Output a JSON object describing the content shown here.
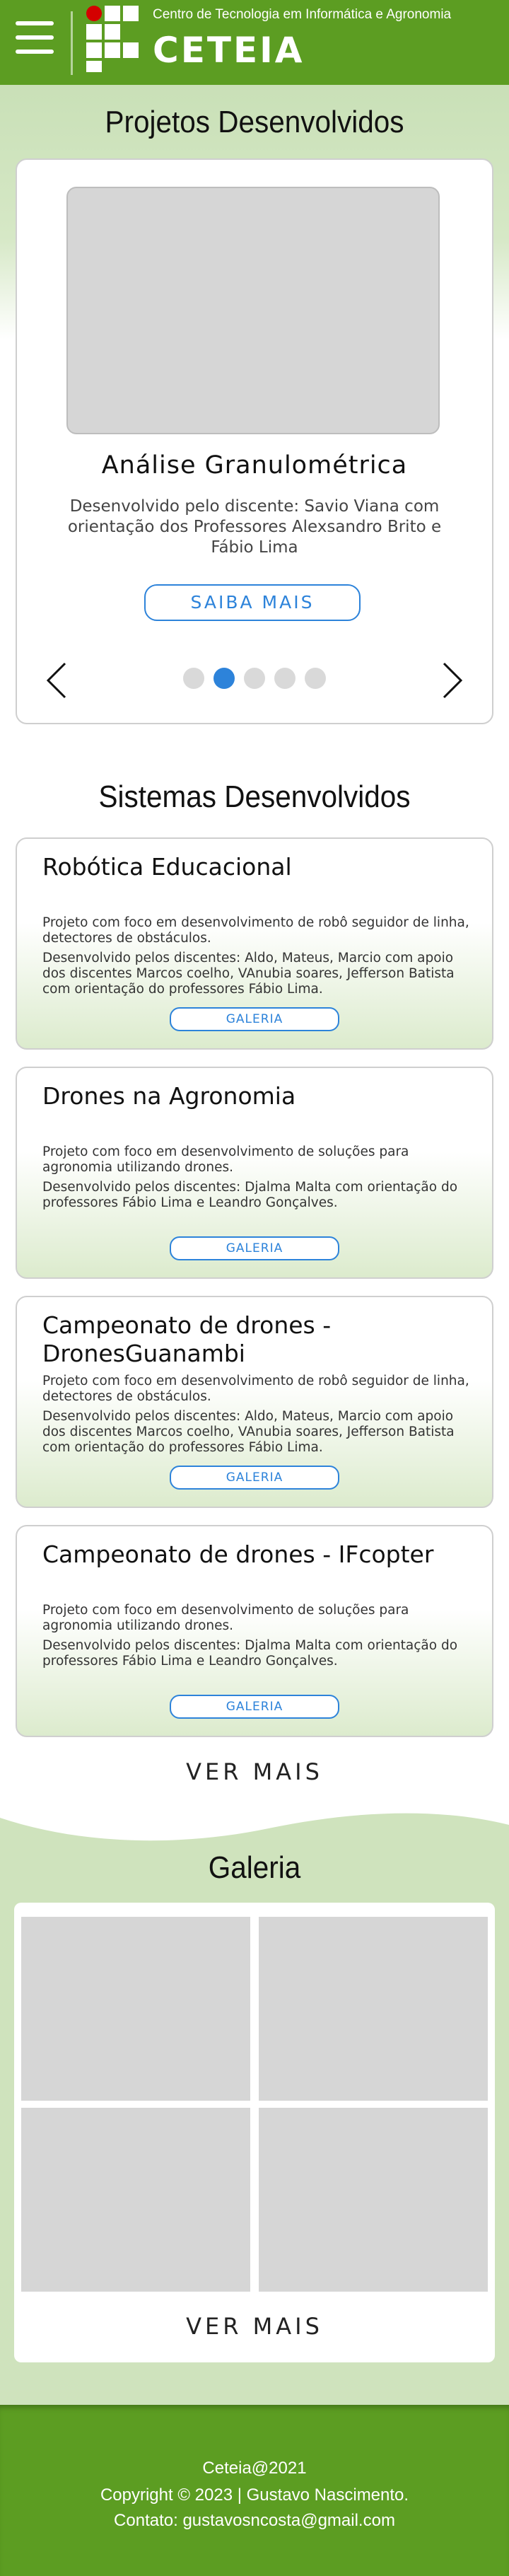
{
  "header": {
    "subtitle": "Centro de Tecnologia em Informática e Agronomia",
    "title": "CETEIA",
    "menu_icon": "hamburger-icon",
    "colors": {
      "brand_green": "#5c9d22",
      "logo_red": "#d40000"
    }
  },
  "projects": {
    "section_title": "Projetos Desenvolvidos",
    "current": {
      "title": "Análise Granulométrica",
      "description": "Desenvolvido pelo discente: Savio Viana com orientação dos Professores Alexsandro Brito e Fábio Lima",
      "button": "SAIBA MAIS"
    },
    "slide_count": 5,
    "active_slide": 2,
    "accent": "#2d83da"
  },
  "systems": {
    "section_title": "Sistemas Desenvolvidos",
    "cards": [
      {
        "title": "Robótica Educacional",
        "desc": "Projeto com foco em desenvolvimento de robô seguidor de linha, detectores de obstáculos.",
        "team": "Desenvolvido pelos discentes: Aldo, Mateus, Marcio com apoio dos discentes Marcos coelho, VAnubia soares, Jefferson Batista com orientação do professores Fábio Lima.",
        "button": "GALERIA"
      },
      {
        "title": "Drones na Agronomia",
        "desc": "Projeto com foco em desenvolvimento de soluções para agronomia utilizando drones.",
        "team": "Desenvolvido pelos discentes: Djalma Malta com orientação do professores Fábio Lima e Leandro Gonçalves.",
        "button": "GALERIA"
      },
      {
        "title": "Campeonato de drones - DronesGuanambi",
        "desc": "Projeto com foco em desenvolvimento de robô seguidor de linha, detectores de obstáculos.",
        "team": "Desenvolvido pelos discentes: Aldo, Mateus, Marcio com apoio dos discentes Marcos coelho, VAnubia soares, Jefferson Batista com orientação do professores Fábio Lima.",
        "button": "GALERIA"
      },
      {
        "title": "Campeonato de drones - IFcopter",
        "desc": "Projeto com foco em desenvolvimento de soluções para agronomia utilizando drones.",
        "team": "Desenvolvido pelos discentes: Djalma Malta com orientação do professores Fábio Lima e Leandro Gonçalves.",
        "button": "GALERIA"
      }
    ],
    "more": "VER MAIS"
  },
  "gallery": {
    "section_title": "Galeria",
    "more": "VER MAIS"
  },
  "footer": {
    "line1": "Ceteia@2021",
    "line2": "Copyright © 2023 | Gustavo Nascimento.",
    "line3": "Contato: gustavosncosta@gmail.com"
  }
}
